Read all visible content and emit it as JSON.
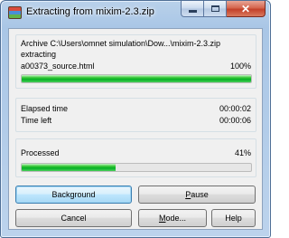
{
  "window": {
    "title": "Extracting from mixim-2.3.zip",
    "app_icon": "winrar-books-icon",
    "close_glyph": "✕"
  },
  "archive_group": {
    "archive_line": "Archive C:\\Users\\omnet simulation\\Dow...\\mixim-2.3.zip",
    "action": "extracting",
    "file_name": "a00373_source.html",
    "file_percent": "100%",
    "file_progress_fraction": 1.0
  },
  "time_group": {
    "elapsed_label": "Elapsed time",
    "elapsed_value": "00:00:02",
    "left_label": "Time left",
    "left_value": "00:00:06"
  },
  "processed_group": {
    "label": "Processed",
    "percent": "41%",
    "progress_fraction": 0.41
  },
  "buttons": {
    "background": "Background",
    "pause_mnemonic": "P",
    "pause_rest": "ause",
    "cancel": "Cancel",
    "mode_mnemonic": "M",
    "mode_rest": "ode...",
    "help": "Help"
  },
  "colors": {
    "progress_green": "#06b025",
    "window_frame": "#a9c6e6",
    "close_red": "#c3402a"
  }
}
